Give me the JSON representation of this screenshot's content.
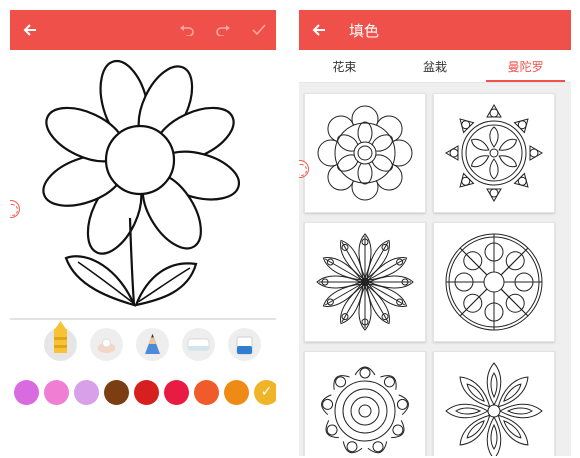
{
  "left_screen": {
    "appbar": {
      "back_icon": "arrow-left-icon",
      "actions": [
        "undo-icon",
        "redo-icon",
        "check-icon"
      ]
    },
    "tools": [
      "crayon",
      "spray",
      "pencil",
      "eraser",
      "bucket"
    ],
    "colors": [
      "#d96be0",
      "#f07fd4",
      "#d7a0e8",
      "#7a3e12",
      "#d61f1f",
      "#e81c43",
      "#ef5b2a",
      "#f08a17",
      "#f0b428"
    ],
    "selected_color_index": 8
  },
  "right_screen": {
    "appbar": {
      "back_icon": "arrow-left-icon",
      "title": "填色"
    },
    "tabs": [
      {
        "label": "花束",
        "active": false
      },
      {
        "label": "盆栽",
        "active": false
      },
      {
        "label": "曼陀罗",
        "active": true
      }
    ],
    "gallery": [
      "mandala-1",
      "mandala-2",
      "mandala-3",
      "mandala-4",
      "mandala-5",
      "mandala-6"
    ]
  }
}
